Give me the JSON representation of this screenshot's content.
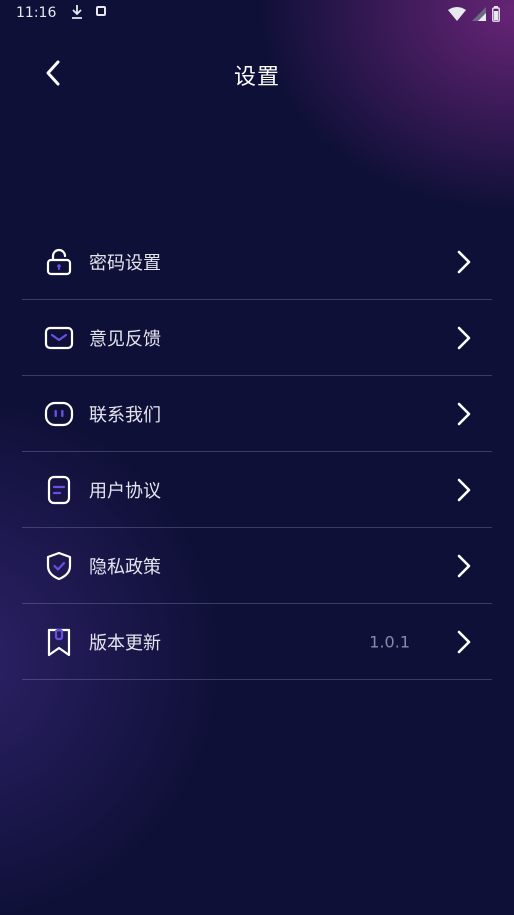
{
  "status_bar": {
    "time": "11:16"
  },
  "header": {
    "title": "设置",
    "back_icon": "chevron-left-icon"
  },
  "menu": {
    "items": [
      {
        "label": "密码设置",
        "icon": "lock-icon",
        "value": ""
      },
      {
        "label": "意见反馈",
        "icon": "mail-icon",
        "value": ""
      },
      {
        "label": "联系我们",
        "icon": "chat-icon",
        "value": ""
      },
      {
        "label": "用户协议",
        "icon": "document-icon",
        "value": ""
      },
      {
        "label": "隐私政策",
        "icon": "shield-icon",
        "value": ""
      },
      {
        "label": "版本更新",
        "icon": "bookmark-icon",
        "value": "1.0.1"
      }
    ]
  },
  "colors": {
    "background": "#0f1038",
    "accent": "#6b4fe0",
    "text": "#e4e4ee",
    "muted_text": "#8a8aa8"
  }
}
